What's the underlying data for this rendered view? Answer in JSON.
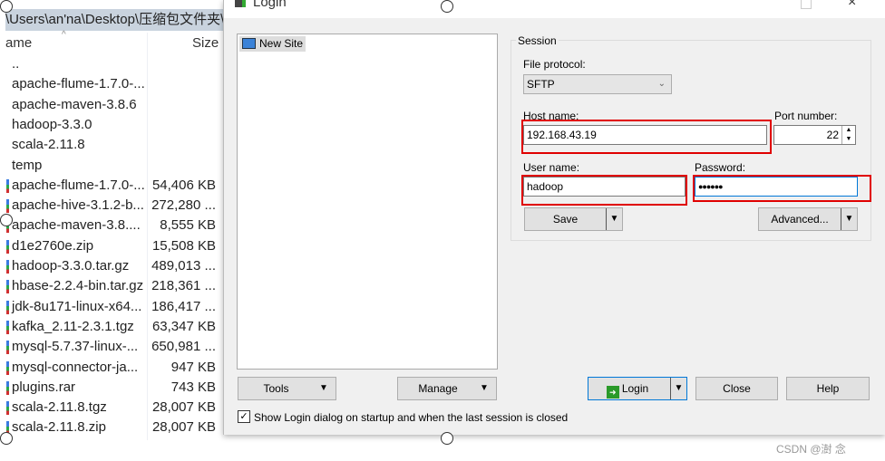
{
  "explorer": {
    "path": "\\Users\\an'na\\Desktop\\压缩包文件夹\\",
    "col_name": "ame",
    "col_size": "Size",
    "files": [
      {
        "name": "..",
        "size": "",
        "dir": true
      },
      {
        "name": "apache-flume-1.7.0-...",
        "size": "",
        "dir": true
      },
      {
        "name": "apache-maven-3.8.6",
        "size": "",
        "dir": true
      },
      {
        "name": "hadoop-3.3.0",
        "size": "",
        "dir": true
      },
      {
        "name": "scala-2.11.8",
        "size": "",
        "dir": true
      },
      {
        "name": "temp",
        "size": "",
        "dir": true
      },
      {
        "name": "apache-flume-1.7.0-...",
        "size": "54,406 KB"
      },
      {
        "name": "apache-hive-3.1.2-b...",
        "size": "272,280 ..."
      },
      {
        "name": "apache-maven-3.8....",
        "size": "8,555 KB"
      },
      {
        "name": "d1e2760e.zip",
        "size": "15,508 KB"
      },
      {
        "name": "hadoop-3.3.0.tar.gz",
        "size": "489,013 ..."
      },
      {
        "name": "hbase-2.2.4-bin.tar.gz",
        "size": "218,361 ..."
      },
      {
        "name": "jdk-8u171-linux-x64...",
        "size": "186,417 ..."
      },
      {
        "name": "kafka_2.11-2.3.1.tgz",
        "size": "63,347 KB"
      },
      {
        "name": "mysql-5.7.37-linux-...",
        "size": "650,981 ..."
      },
      {
        "name": "mysql-connector-ja...",
        "size": "947 KB"
      },
      {
        "name": "plugins.rar",
        "size": "743 KB"
      },
      {
        "name": "scala-2.11.8.tgz",
        "size": "28,007 KB"
      },
      {
        "name": "scala-2.11.8.zip",
        "size": "28,007 KB"
      }
    ]
  },
  "dialog": {
    "title": "Login",
    "site_tree": {
      "items": [
        "New Site"
      ]
    },
    "session": {
      "group_label": "Session",
      "file_protocol_label": "File protocol:",
      "file_protocol": "SFTP",
      "host_label": "Host name:",
      "host": "192.168.43.19",
      "port_label": "Port number:",
      "port": "22",
      "user_label": "User name:",
      "user": "hadoop",
      "password_label": "Password:",
      "password_mask": "●●●●●●",
      "save": "Save",
      "advanced": "Advanced..."
    },
    "buttons": {
      "tools": "Tools",
      "manage": "Manage",
      "login": "Login",
      "close": "Close",
      "help": "Help"
    },
    "show_login_checkbox": {
      "label": "Show Login dialog on startup and when the last session is closed",
      "checked": true
    },
    "highlight_color": "#e00000"
  },
  "watermark": "CSDN @澍 念"
}
